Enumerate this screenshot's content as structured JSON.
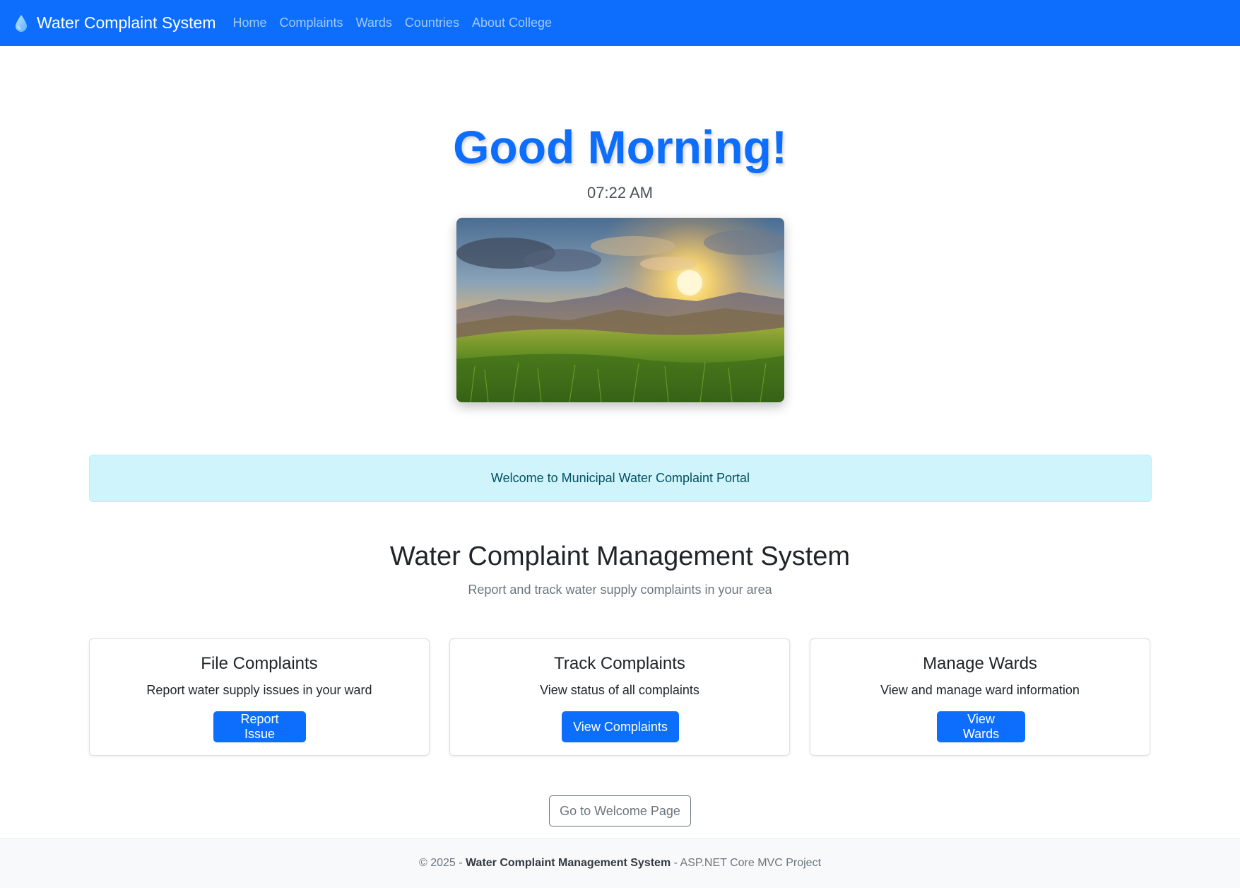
{
  "navbar": {
    "brand": "Water Complaint System",
    "brand_icon": "water-drop-icon",
    "links": [
      {
        "label": "Home"
      },
      {
        "label": "Complaints"
      },
      {
        "label": "Wards"
      },
      {
        "label": "Countries"
      },
      {
        "label": "About College"
      }
    ]
  },
  "hero": {
    "greeting": "Good Morning!",
    "time": "07:22 AM",
    "image": "sunrise-mountain-meadow"
  },
  "alert": {
    "text": "Welcome to Municipal Water Complaint Portal"
  },
  "section": {
    "title": "Water Complaint Management System",
    "subtitle": "Report and track water supply complaints in your area"
  },
  "cards": [
    {
      "title": "File Complaints",
      "text": "Report water supply issues in your ward",
      "button": "Report Issue"
    },
    {
      "title": "Track Complaints",
      "text": "View status of all complaints",
      "button": "View Complaints"
    },
    {
      "title": "Manage Wards",
      "text": "View and manage ward information",
      "button": "View Wards"
    }
  ],
  "welcome_button": "Go to Welcome Page",
  "footer": {
    "prefix": "© 2025 -",
    "app_name": "Water Complaint Management System",
    "suffix": "- ASP.NET Core MVC Project"
  },
  "colors": {
    "primary": "#0d6efd",
    "alert_bg": "#cff4fc",
    "alert_text": "#055160",
    "footer_bg": "#f8f9fa"
  }
}
